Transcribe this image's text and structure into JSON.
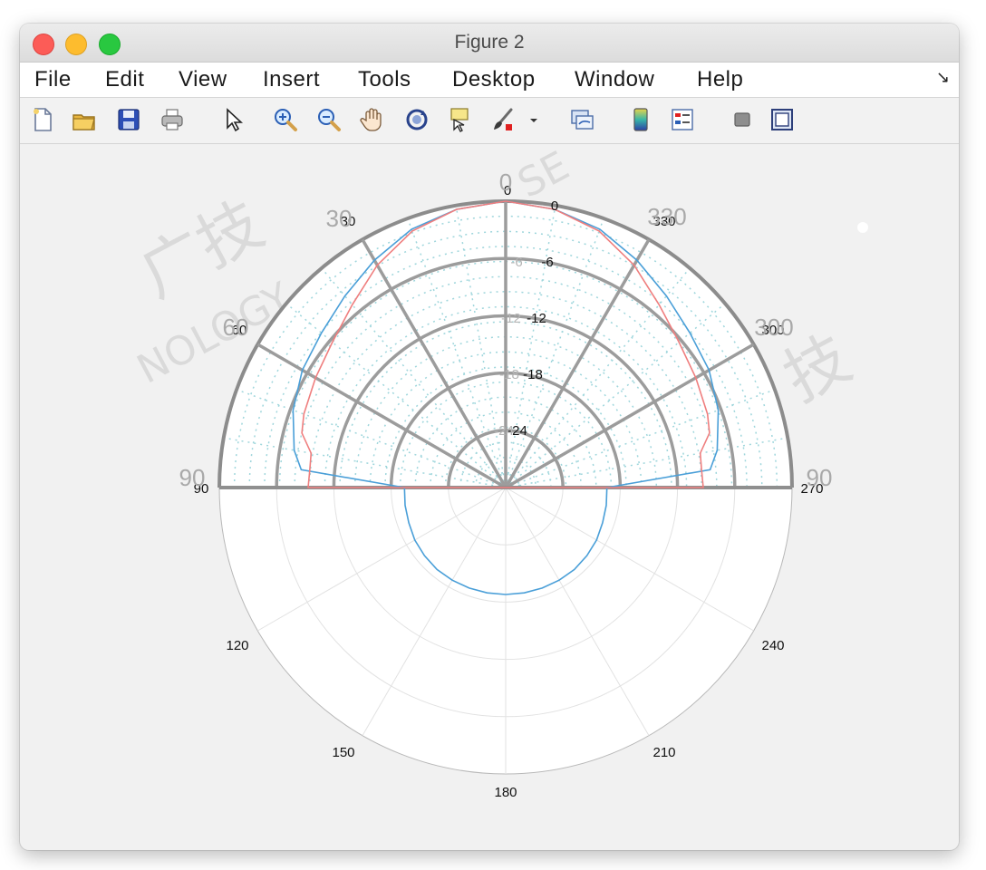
{
  "window": {
    "title": "Figure 2"
  },
  "menu": {
    "items": [
      "File",
      "Edit",
      "View",
      "Insert",
      "Tools",
      "Desktop",
      "Window",
      "Help"
    ]
  },
  "toolbar": {
    "icons": [
      "new-figure-icon",
      "open-file-icon",
      "save-icon",
      "print-icon",
      "pointer-icon",
      "zoom-in-icon",
      "zoom-out-icon",
      "pan-hand-icon",
      "rotate-3d-icon",
      "data-cursor-icon",
      "brush-icon",
      "brush-dropdown-icon",
      "link-plot-icon",
      "colorbar-icon",
      "legend-icon",
      "hide-plot-tools-icon",
      "show-plot-tools-icon"
    ]
  },
  "chart_data": [
    {
      "type": "polar",
      "angle_ticks": [
        "0",
        "30",
        "60",
        "90",
        "120",
        "150",
        "180",
        "210",
        "240",
        "270",
        "300",
        "330"
      ],
      "angles_deg": [
        0,
        30,
        60,
        90,
        120,
        150,
        180,
        210,
        240,
        270,
        300,
        330
      ],
      "radial_ticks": [
        "0",
        "-6",
        "-12",
        "-18",
        "-24"
      ],
      "radial_values": [
        0,
        -6,
        -12,
        -18,
        -24
      ],
      "rlim": [
        -30,
        0
      ],
      "series": [
        {
          "color": "#4a9fd8",
          "theta": [
            0,
            10,
            20,
            30,
            40,
            50,
            60,
            70,
            80,
            85,
            90,
            100,
            110,
            120,
            130,
            140,
            150,
            160,
            170,
            180,
            190,
            200,
            210,
            220,
            230,
            240,
            250,
            260,
            270,
            275,
            280,
            290,
            300,
            310,
            320,
            330,
            340,
            350,
            360
          ],
          "r": [
            0,
            -0.4,
            -1.2,
            -2.5,
            -3.8,
            -4.8,
            -5.4,
            -6.3,
            -7.5,
            -8.5,
            -19.4,
            -19.3,
            -19.2,
            -19.0,
            -18.9,
            -18.8,
            -18.8,
            -18.8,
            -18.8,
            -18.8,
            -18.8,
            -18.8,
            -18.8,
            -18.8,
            -18.9,
            -19.0,
            -19.2,
            -19.3,
            -19.4,
            -8.5,
            -7.5,
            -6.3,
            -5.4,
            -4.8,
            -3.8,
            -2.5,
            -1.2,
            -0.4,
            0
          ]
        },
        {
          "color": "#ef7e7e",
          "theta": [
            0,
            10,
            20,
            30,
            40,
            50,
            60,
            70,
            75,
            80,
            85,
            90,
            270,
            275,
            280,
            285,
            290,
            300,
            310,
            320,
            330,
            340,
            350,
            360
          ],
          "r": [
            0,
            -0.4,
            -1.4,
            -3.1,
            -5.0,
            -6.3,
            -7.0,
            -7.5,
            -7.9,
            -9.3,
            -9.4,
            -9.3,
            -9.3,
            -9.4,
            -9.3,
            -7.9,
            -7.5,
            -7.0,
            -6.3,
            -5.0,
            -3.1,
            -1.4,
            -0.4,
            0
          ]
        }
      ]
    },
    {
      "type": "polar",
      "angle_ticks": [
        "0",
        "30",
        "60",
        "90",
        "330",
        "300",
        "90"
      ],
      "radial_ticks": [
        "-6",
        "-12",
        "-18",
        "-24"
      ],
      "note_ticks": "grey overlay ticks"
    }
  ]
}
